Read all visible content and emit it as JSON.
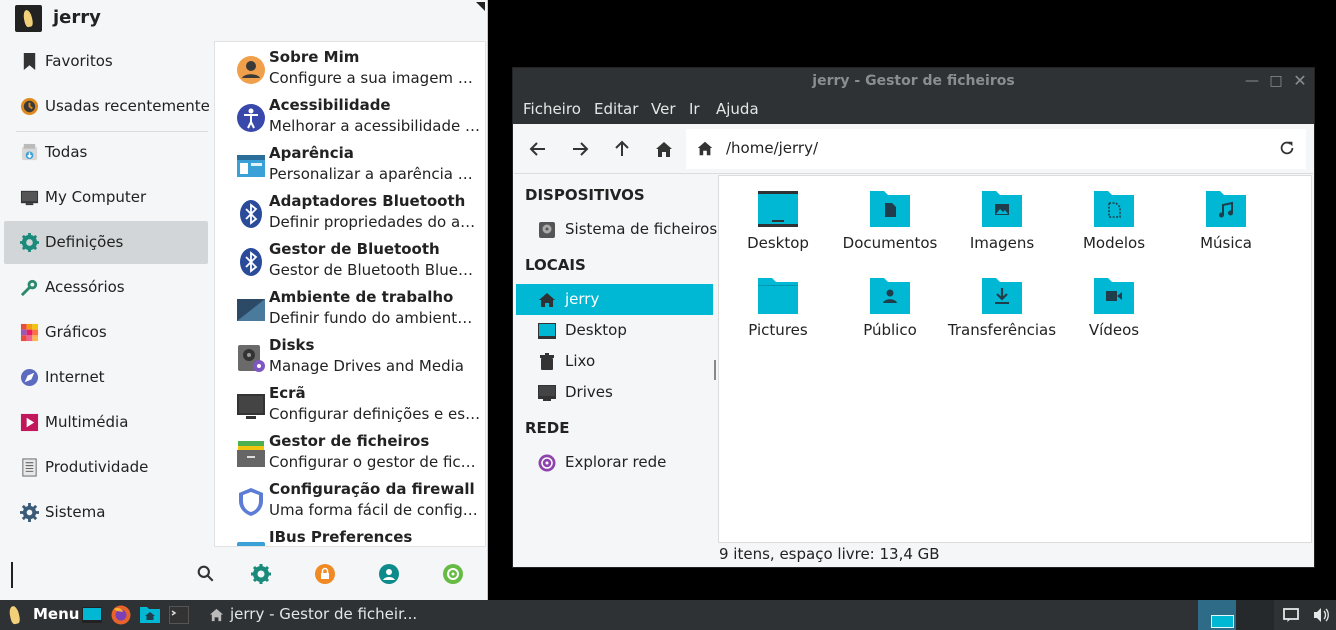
{
  "menu": {
    "user": "jerry",
    "categories": [
      {
        "label": "Favoritos",
        "icon": "bookmark-icon"
      },
      {
        "label": "Usadas recentemente",
        "icon": "recent-icon"
      },
      {
        "label": "Todas",
        "icon": "all-apps-icon"
      },
      {
        "label": "My Computer",
        "icon": "computer-icon"
      },
      {
        "label": "Definições",
        "icon": "settings-icon",
        "selected": true
      },
      {
        "label": "Acessórios",
        "icon": "accessories-icon"
      },
      {
        "label": "Gráficos",
        "icon": "graphics-icon"
      },
      {
        "label": "Internet",
        "icon": "internet-icon"
      },
      {
        "label": "Multimédia",
        "icon": "multimedia-icon"
      },
      {
        "label": "Produtividade",
        "icon": "productivity-icon"
      },
      {
        "label": "Sistema",
        "icon": "system-gear-icon"
      }
    ],
    "apps": [
      {
        "title": "Sobre Mim",
        "desc": "Configure a sua imagem de utilizador",
        "icon": "user-avatar-icon"
      },
      {
        "title": "Acessibilidade",
        "desc": "Melhorar a acessibilidade do ambiente",
        "icon": "accessibility-icon"
      },
      {
        "title": "Aparência",
        "desc": "Personalizar a aparência do ambiente",
        "icon": "appearance-icon"
      },
      {
        "title": "Adaptadores Bluetooth",
        "desc": "Definir propriedades do adaptador",
        "icon": "bluetooth-icon"
      },
      {
        "title": "Gestor de Bluetooth",
        "desc": "Gestor de Bluetooth Blueman",
        "icon": "bluetooth-icon"
      },
      {
        "title": "Ambiente de trabalho",
        "desc": "Definir fundo do ambiente de trabalho",
        "icon": "desktop-settings-icon"
      },
      {
        "title": "Disks",
        "desc": "Manage Drives and Media",
        "icon": "disks-icon"
      },
      {
        "title": "Ecrã",
        "desc": "Configurar definições e esquemas",
        "icon": "display-icon"
      },
      {
        "title": "Gestor de ficheiros",
        "desc": "Configurar o gestor de ficheiros",
        "icon": "file-manager-icon"
      },
      {
        "title": "Configuração da firewall",
        "desc": "Uma forma fácil de configurar a firewall",
        "icon": "firewall-shield-icon"
      },
      {
        "title": "IBus Preferences",
        "desc": "",
        "icon": "ibus-icon"
      }
    ],
    "search": {
      "value": "",
      "placeholder": ""
    },
    "footer_icons": [
      "search-icon",
      "settings-icon",
      "lock-icon",
      "user-icon",
      "logout-icon"
    ]
  },
  "fm": {
    "title": "jerry - Gestor de ficheiros",
    "menus": [
      "Ficheiro",
      "Editar",
      "Ver",
      "Ir",
      "Ajuda"
    ],
    "path": "/home/jerry/",
    "sections": {
      "devices": "DISPOSITIVOS",
      "places": "LOCAIS",
      "network": "REDE"
    },
    "devices": [
      {
        "label": "Sistema de ficheiros",
        "icon": "harddisk-icon"
      }
    ],
    "places": [
      {
        "label": "jerry",
        "icon": "home-icon",
        "selected": true
      },
      {
        "label": "Desktop",
        "icon": "desktop-icon"
      },
      {
        "label": "Lixo",
        "icon": "trash-icon"
      },
      {
        "label": "Drives",
        "icon": "drives-icon"
      }
    ],
    "network": [
      {
        "label": "Explorar rede",
        "icon": "network-icon"
      }
    ],
    "items": [
      {
        "label": "Desktop",
        "icon": "desktop-folder-icon"
      },
      {
        "label": "Documentos",
        "icon": "documents-folder-icon"
      },
      {
        "label": "Imagens",
        "icon": "images-folder-icon"
      },
      {
        "label": "Modelos",
        "icon": "templates-folder-icon"
      },
      {
        "label": "Música",
        "icon": "music-folder-icon"
      },
      {
        "label": "Pictures",
        "icon": "folder-icon"
      },
      {
        "label": "Público",
        "icon": "public-folder-icon"
      },
      {
        "label": "Transferências",
        "icon": "downloads-folder-icon"
      },
      {
        "label": "Vídeos",
        "icon": "videos-folder-icon"
      }
    ],
    "status": "9 itens, espaço livre: 13,4 GB"
  },
  "taskbar": {
    "menu_label": "Menu",
    "task_label": "jerry - Gestor de ficheir..."
  },
  "colors": {
    "accent": "#00b8d4",
    "dark": "#2f3234",
    "menu_bg": "#f5f6f7"
  }
}
